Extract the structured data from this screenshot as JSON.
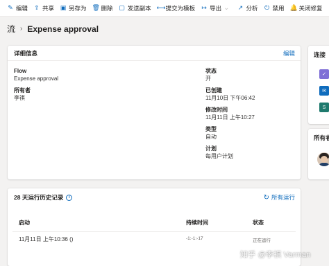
{
  "toolbar": {
    "items": [
      {
        "icon": "edit-icon",
        "glyph": "✎",
        "label": "编辑"
      },
      {
        "icon": "share-icon",
        "glyph": "⇪",
        "label": "共享"
      },
      {
        "icon": "save-as-icon",
        "glyph": "▣",
        "label": "另存为"
      },
      {
        "icon": "delete-icon",
        "glyph": "🗑",
        "label": "删除"
      },
      {
        "icon": "send-copy-icon",
        "glyph": "▢",
        "label": "发送副本"
      },
      {
        "icon": "submit-template-icon",
        "glyph": "⟷",
        "label": "提交为模板"
      },
      {
        "icon": "export-icon",
        "glyph": "↦",
        "label": "导出"
      },
      {
        "icon": "analytics-icon",
        "glyph": "↗",
        "label": "分析"
      },
      {
        "icon": "disable-icon",
        "glyph": "⏻",
        "label": "禁用"
      },
      {
        "icon": "bell-off-icon",
        "glyph": "🔔",
        "label": "关闭修复"
      }
    ]
  },
  "breadcrumb": {
    "root": "流",
    "title": "Expense approval"
  },
  "details": {
    "title": "详细信息",
    "edit_link": "编辑",
    "flow_label": "Flow",
    "flow_value": "Expense approval",
    "owner_label": "所有者",
    "owner_value": "李祺",
    "status_label": "状态",
    "status_value": "开",
    "created_label": "已创建",
    "created_value": "11月10日 下午06:42",
    "modified_label": "修改时间",
    "modified_value": "11月11日 上午10:27",
    "type_label": "类型",
    "type_value": "自动",
    "plan_label": "计划",
    "plan_value": "每用户计划"
  },
  "history": {
    "title": "28 天运行历史记录",
    "all_runs": "所有运行",
    "columns": [
      "启动",
      "持续时间",
      "状态"
    ],
    "rows": [
      {
        "start": "11月11日 上午10:36 ()",
        "duration": "-1:-1:-17",
        "status": "正在运行"
      }
    ]
  },
  "side": {
    "connections_title": "连接",
    "owners_title": "所有者",
    "connection_colors": [
      "#7f6fd6",
      "#0f6cbd",
      "#1f7a6e"
    ]
  },
  "watermark": "知乎 @李祺 Varman"
}
